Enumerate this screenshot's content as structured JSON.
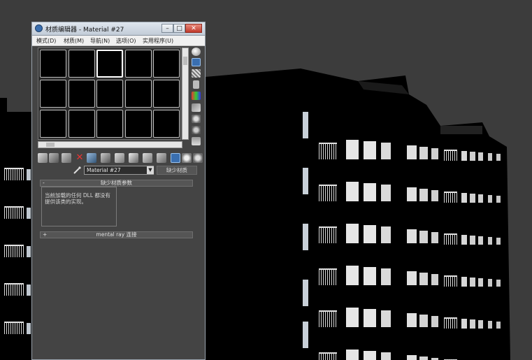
{
  "window": {
    "title": "材质编辑器 - Material #27",
    "min_glyph": "–",
    "max_glyph": "□",
    "close_glyph": "✕"
  },
  "menu": [
    "模式(D)",
    "材质(M)",
    "导航(N)",
    "选项(O)",
    "实用程序(U)"
  ],
  "slots": {
    "rows": 3,
    "cols": 5,
    "active_index": 2
  },
  "material": {
    "name": "Material #27",
    "dropdown_glyph": "▼",
    "type_button": "缺少材质"
  },
  "rollouts": {
    "missing": {
      "sign": "-",
      "title": "缺少材质参数"
    },
    "mentalray": {
      "sign": "+",
      "title": "mental ray 连接"
    }
  },
  "info_text": "当前加载的任何 DLL 都没有提供该类的实现。",
  "colors": {
    "background": "#3c3c3c",
    "panel": "#444444",
    "titlebar": "#d0d8e2",
    "accent_blue": "#3a6fb0"
  }
}
